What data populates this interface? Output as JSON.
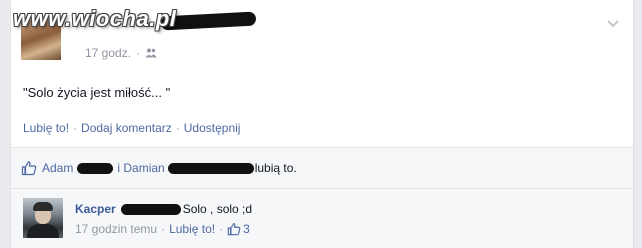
{
  "watermark": "www.wiocha.pl",
  "post": {
    "time": "17 godz.",
    "separator": "·",
    "text": "\"Solo życia jest miłość... \"",
    "actions": {
      "like": "Lubię to!",
      "comment": "Dodaj komentarz",
      "share": "Udostępnij",
      "separator": "·"
    }
  },
  "likes": {
    "name1": "Adam",
    "joiner": "i Damian",
    "suffix": "lubią to."
  },
  "comment": {
    "author": "Kacper",
    "text": "Solo , solo ;d",
    "time": "17 godzin temu",
    "separator": "·",
    "like": "Lubię to!",
    "like_count": "3"
  },
  "icons": {
    "audience": "friends-icon",
    "menu": "chevron-down-icon",
    "like": "thumbs-up-icon"
  },
  "colors": {
    "link": "#4e69a2",
    "author": "#3b5998",
    "muted": "#9197a3",
    "background": "#e9ebee"
  }
}
